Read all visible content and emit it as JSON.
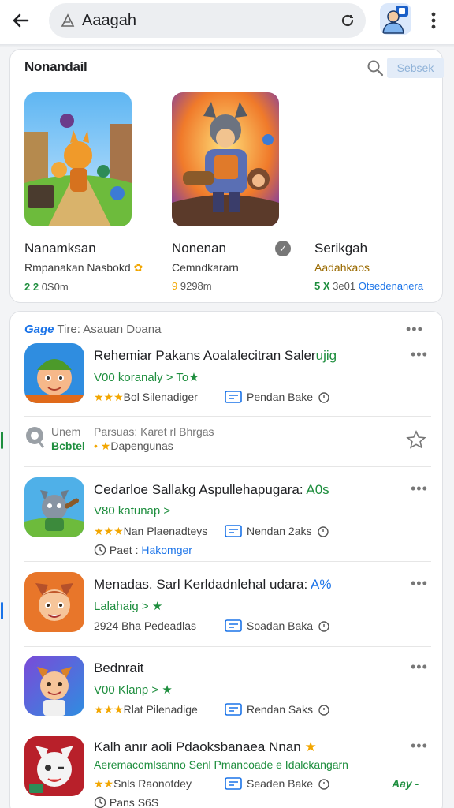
{
  "topbar": {
    "search_value": "Aaagah",
    "back_icon": "arrow-left-icon",
    "search_icon": "triangle-logo-icon",
    "refresh_icon": "refresh-icon",
    "avatar_icon": "account-avatar-icon",
    "menu_icon": "more-vert-icon"
  },
  "featured": {
    "title": "Nonandail",
    "badge": "Sebsek",
    "items": [
      {
        "name": "Nanamksan",
        "sub": "Rmpanakan Nasbokd",
        "meta_a": "2 2",
        "meta_b": "0S0m"
      },
      {
        "name": "Nonenan",
        "sub": "Cemndkararn",
        "meta_a": "9",
        "meta_b": "9298m"
      },
      {
        "name": "Serikgah",
        "sub": "Aadahkaos",
        "meta_a": "5 X",
        "meta_b": "3e01",
        "meta_c": "Otsedenanera"
      }
    ]
  },
  "list": {
    "header_highlight": "Gage",
    "header_rest": "Tire: Asauan Doana",
    "rows": [
      {
        "title": "Rehemiar Pakans Aoalalecitran Saler",
        "title_accent": "ujig",
        "line2": "V00 koranaly > To",
        "rating": "Bol Silenadiger",
        "right_label": "Pendan Bake"
      },
      {
        "title": "Cedarloe Sallakg Aspullehapugara:",
        "title_accent": "A0s",
        "line2": "V80 katunap >",
        "rating": "Nan Plaenadteys",
        "right_label": "Nendan 2aks",
        "line4_a": "Paet :",
        "line4_b": "Hakomger"
      },
      {
        "title": "Menadas. Sarl Kerldadnlehal udara:",
        "title_accent": "A%",
        "line2": "Lalahaig > ",
        "rating": "2924 Bha Pedeadlas",
        "right_label": "Soadan Baka"
      },
      {
        "title": "Bednrait",
        "title_accent": "",
        "line2": "V00 Klanp >",
        "rating": "Rlat Pilenadige",
        "right_label": "Rendan Saks"
      },
      {
        "title": "Kalh anır aoli Pdaoksbanaea Nnan",
        "title_accent": "",
        "line2": "Aeremacomlsanno Senl Pmancoade e Idalckangarn",
        "rating": "Snls Raonotdey",
        "right_label": "Seaden Bake",
        "line4_a": "Pans",
        "line4_b": "S6S",
        "tag": "Aay -"
      }
    ],
    "suggest": {
      "left_1": "Unem",
      "left_2": "Bcbtel",
      "right_1": "Parsuas: Karet rl Bhrgas",
      "right_2": "Dapengunas"
    }
  }
}
